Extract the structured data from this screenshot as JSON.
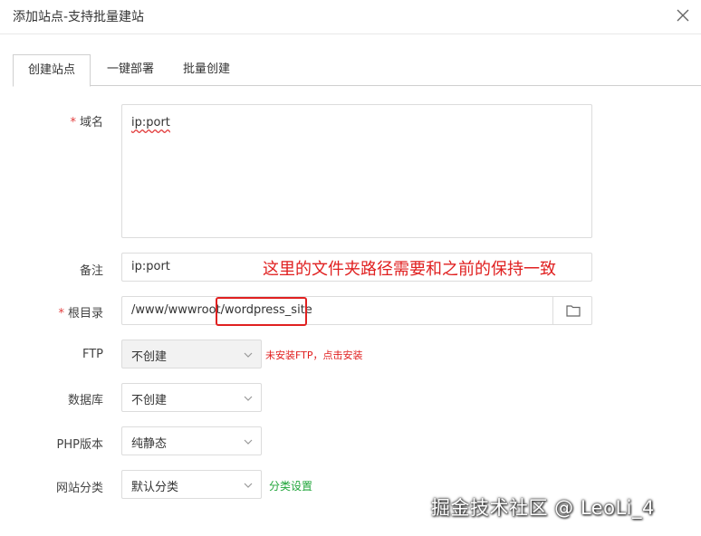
{
  "dialog": {
    "title": "添加站点-支持批量建站",
    "close_icon": "close-icon"
  },
  "tabs": [
    {
      "label": "创建站点",
      "active": true
    },
    {
      "label": "一键部署",
      "active": false
    },
    {
      "label": "批量创建",
      "active": false
    }
  ],
  "form": {
    "domain": {
      "label": "域名",
      "required": true,
      "value": "ip:port"
    },
    "remark": {
      "label": "备注",
      "value": "ip:port"
    },
    "root": {
      "label": "根目录",
      "required": true,
      "value": "/www/wwwroot/wordpress_site",
      "folder_icon": "folder-icon"
    },
    "ftp": {
      "label": "FTP",
      "value": "不创建",
      "disabled": true,
      "hint": "未安装FTP，点击安装"
    },
    "database": {
      "label": "数据库",
      "value": "不创建"
    },
    "php": {
      "label": "PHP版本",
      "value": "纯静态"
    },
    "category": {
      "label": "网站分类",
      "value": "默认分类",
      "link": "分类设置"
    }
  },
  "annotation": "这里的文件夹路径需要和之前的保持一致",
  "watermark": "掘金技术社区 @ LeoLi_4",
  "colors": {
    "required_star": "#e23c3c",
    "annotation_red": "#e02020",
    "link_green": "#20a53a",
    "border": "#dcdcdc"
  }
}
